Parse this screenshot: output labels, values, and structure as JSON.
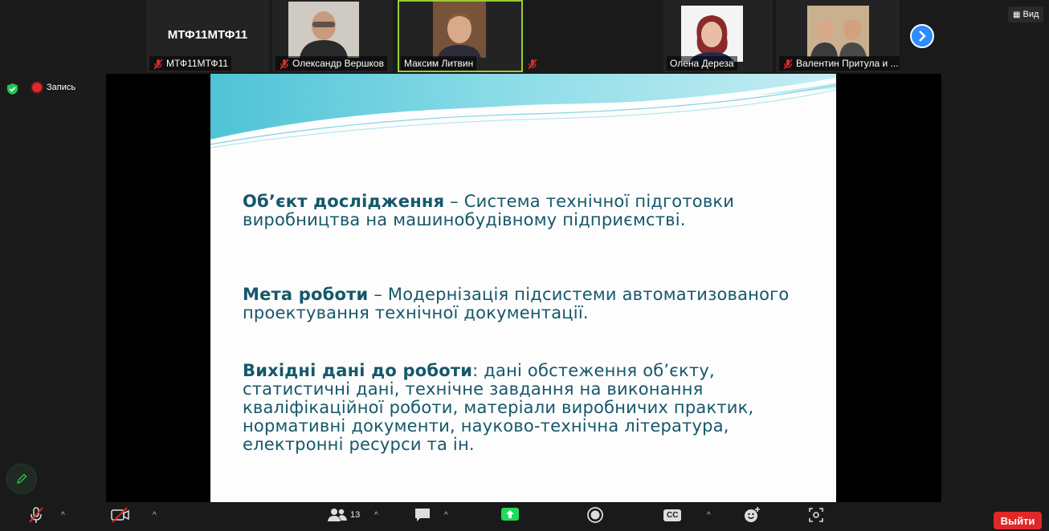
{
  "gallery": {
    "tiles": [
      {
        "big_name": "МТФ11МТФ11",
        "label": "МТФ11МТФ11"
      },
      {
        "label": "Олександр Вершков"
      },
      {
        "label": "Максим Литвин"
      },
      {
        "label": ""
      },
      {
        "label": "Олена Дереза"
      },
      {
        "label": "Валентин Притула и ..."
      }
    ],
    "view_label": "Вид"
  },
  "status": {
    "recording_label": "Запись"
  },
  "slide": {
    "p1_bold": "Об’єкт дослідження",
    "p1_rest": " – Система технічної підготовки виробництва на машинобудівному підприємстві.",
    "p2_bold": "Мета роботи",
    "p2_rest": " – Модернізація підсистеми автоматизованого проектування технічної документації.",
    "p3_bold": "Вихідні дані до роботи",
    "p3_rest": ": дані обстеження об’єкту, статистичні дані, технічне завдання на виконання кваліфікаційної роботи, матеріали виробничих практик, нормативні документи, науково-технічна література, електронні ресурси та ін."
  },
  "toolbar": {
    "participants_count": "13",
    "cc_label": "CC",
    "exit_label": "Выйти"
  },
  "colors": {
    "accent": "#2d8cff",
    "slide_text": "#15586a",
    "exit": "#e02828",
    "share_green": "#23d959"
  }
}
